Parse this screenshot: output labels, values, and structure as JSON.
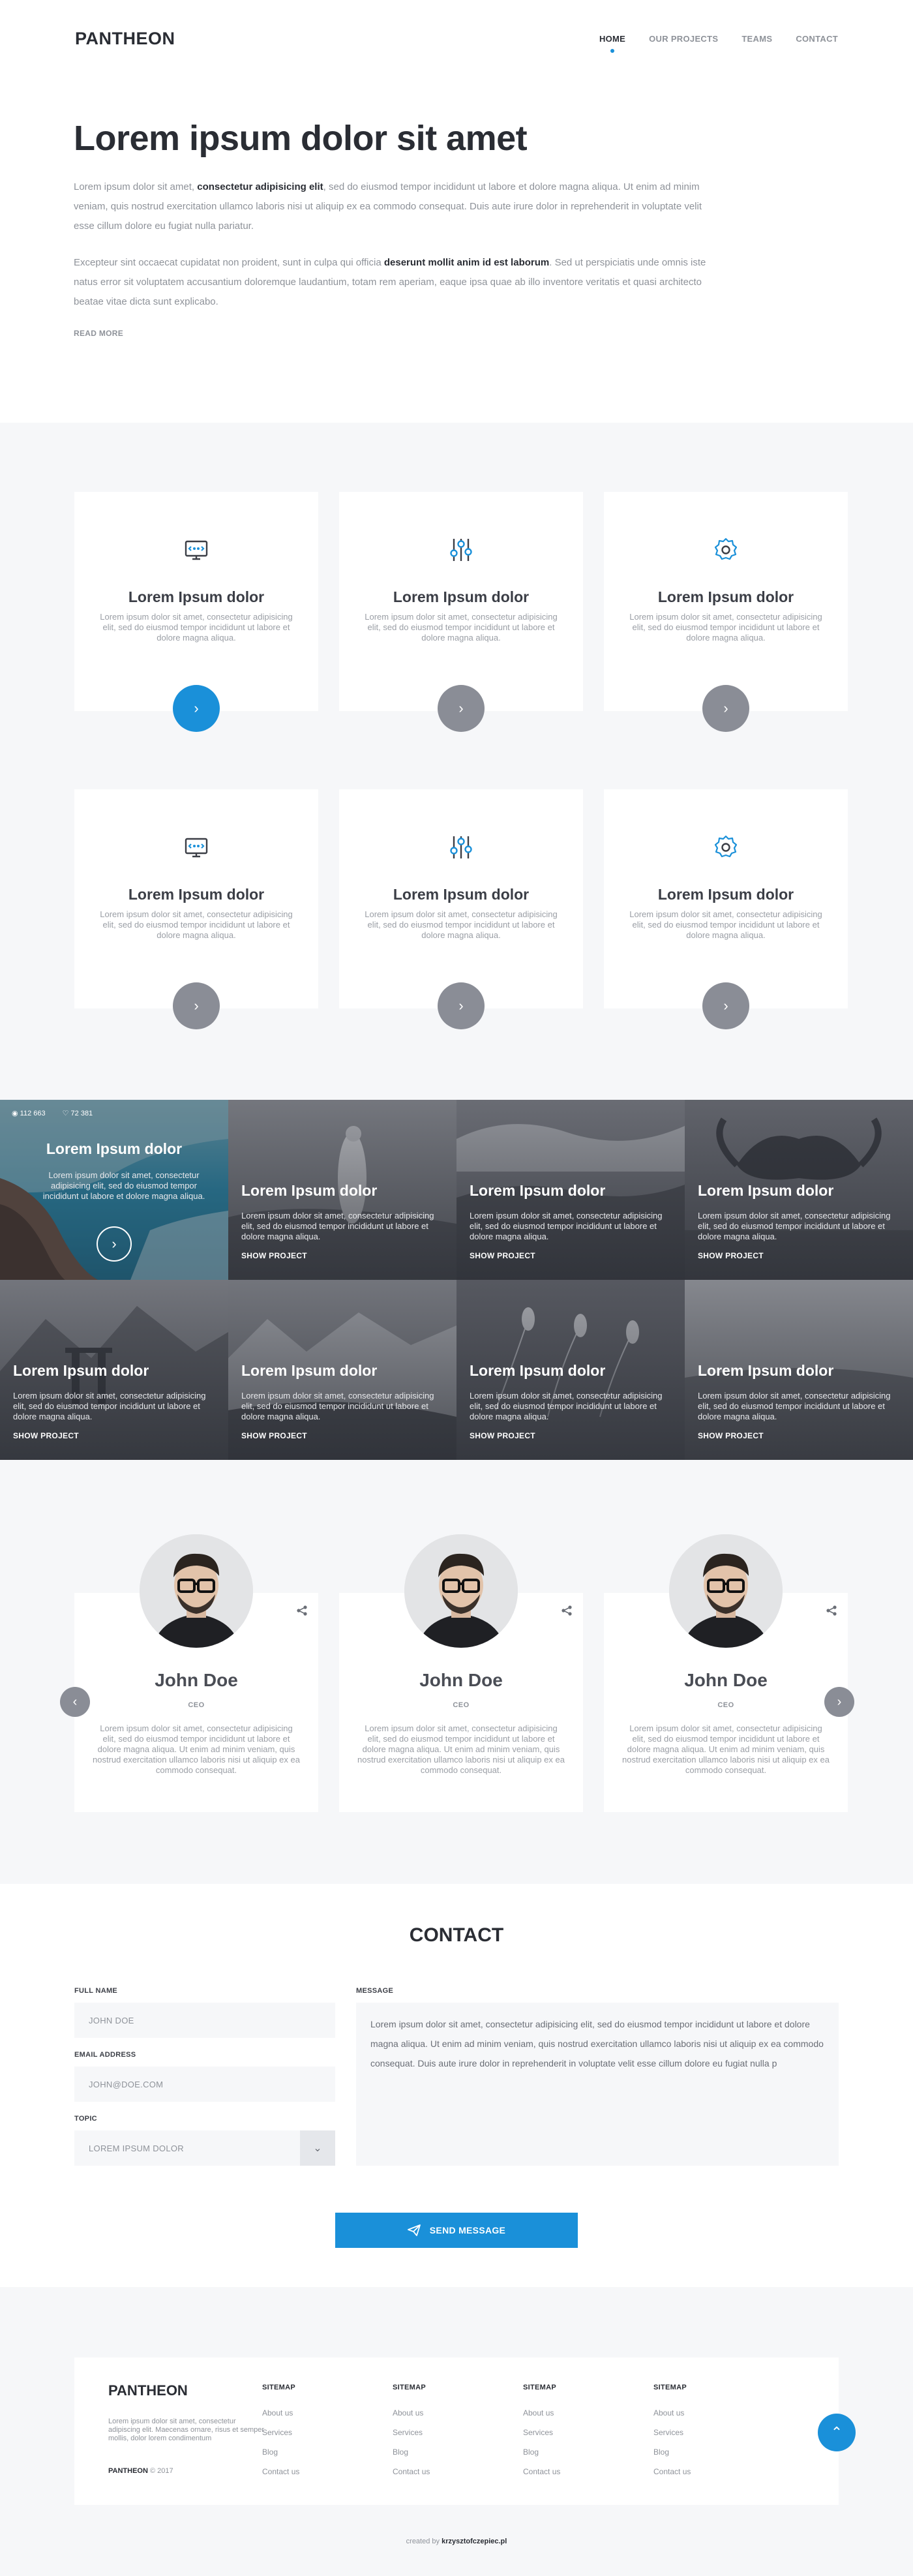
{
  "header": {
    "logo": "PANTHEON",
    "nav": [
      "HOME",
      "OUR PROJECTS",
      "TEAMS",
      "CONTACT"
    ]
  },
  "hero": {
    "title": "Lorem ipsum dolor sit amet",
    "p1_a": "Lorem ipsum dolor sit amet, ",
    "p1_b": "consectetur adipisicing elit",
    "p1_c": ", sed do eiusmod tempor incididunt ut labore et dolore magna aliqua. Ut enim ad minim veniam, quis nostrud exercitation ullamco laboris nisi ut aliquip ex ea commodo consequat. Duis aute irure dolor in reprehenderit in voluptate velit esse cillum dolore eu fugiat nulla pariatur.",
    "p2_a": "Excepteur sint occaecat cupidatat non proident, sunt in culpa qui officia ",
    "p2_b": "deserunt mollit anim id est laborum",
    "p2_c": ". Sed ut perspiciatis unde omnis iste natus error sit voluptatem accusantium doloremque laudantium, totam rem aperiam, eaque ipsa quae ab illo inventore veritatis et quasi architecto beatae vitae dicta sunt explicabo.",
    "read_more": "READ MORE"
  },
  "services": [
    {
      "icon": "monitor-icon",
      "title": "Lorem Ipsum dolor",
      "text": "Lorem ipsum dolor sit amet, consectetur adipisicing elit, sed do eiusmod tempor incididunt ut labore et dolore magna aliqua.",
      "btn": "›"
    },
    {
      "icon": "sliders-icon",
      "title": "Lorem Ipsum dolor",
      "text": "Lorem ipsum dolor sit amet, consectetur adipisicing elit, sed do eiusmod tempor incididunt ut labore et dolore magna aliqua.",
      "btn": "›"
    },
    {
      "icon": "gear-icon",
      "title": "Lorem Ipsum dolor",
      "text": "Lorem ipsum dolor sit amet, consectetur adipisicing elit, sed do eiusmod tempor incididunt ut labore et dolore magna aliqua.",
      "btn": "›"
    },
    {
      "icon": "monitor-icon",
      "title": "Lorem Ipsum dolor",
      "text": "Lorem ipsum dolor sit amet, consectetur adipisicing elit, sed do eiusmod tempor incididunt ut labore et dolore magna aliqua.",
      "btn": "›"
    },
    {
      "icon": "sliders-icon",
      "title": "Lorem Ipsum dolor",
      "text": "Lorem ipsum dolor sit amet, consectetur adipisicing elit, sed do eiusmod tempor incididunt ut labore et dolore magna aliqua.",
      "btn": "›"
    },
    {
      "icon": "gear-icon",
      "title": "Lorem Ipsum dolor",
      "text": "Lorem ipsum dolor sit amet, consectetur adipisicing elit, sed do eiusmod tempor incididunt ut labore et dolore magna aliqua.",
      "btn": "›"
    }
  ],
  "projects": {
    "featured": {
      "views": "112 663",
      "likes": "72 381",
      "title": "Lorem Ipsum dolor",
      "text": "Lorem ipsum dolor sit amet, consectetur adipisicing elit, sed do eiusmod tempor incididunt ut labore et dolore magna aliqua.",
      "play": "›"
    },
    "items": [
      {
        "title": "Lorem Ipsum dolor",
        "text": "Lorem ipsum dolor sit amet, consectetur adipisicing elit, sed do eiusmod tempor incididunt ut labore et dolore magna aliqua.",
        "link": "SHOW PROJECT"
      },
      {
        "title": "Lorem Ipsum dolor",
        "text": "Lorem ipsum dolor sit amet, consectetur adipisicing elit, sed do eiusmod tempor incididunt ut labore et dolore magna aliqua.",
        "link": "SHOW PROJECT"
      },
      {
        "title": "Lorem Ipsum dolor",
        "text": "Lorem ipsum dolor sit amet, consectetur adipisicing elit, sed do eiusmod tempor incididunt ut labore et dolore magna aliqua.",
        "link": "SHOW PROJECT"
      },
      {
        "title": "Lorem Ipsum dolor",
        "text": "Lorem ipsum dolor sit amet, consectetur adipisicing elit, sed do eiusmod tempor incididunt ut labore et dolore magna aliqua.",
        "link": "SHOW PROJECT"
      },
      {
        "title": "Lorem Ipsum dolor",
        "text": "Lorem ipsum dolor sit amet, consectetur adipisicing elit, sed do eiusmod tempor incididunt ut labore et dolore magna aliqua.",
        "link": "SHOW PROJECT"
      },
      {
        "title": "Lorem Ipsum dolor",
        "text": "Lorem ipsum dolor sit amet, consectetur adipisicing elit, sed do eiusmod tempor incididunt ut labore et dolore magna aliqua.",
        "link": "SHOW PROJECT"
      },
      {
        "title": "Lorem Ipsum dolor",
        "text": "Lorem ipsum dolor sit amet, consectetur adipisicing elit, sed do eiusmod tempor incididunt ut labore et dolore magna aliqua.",
        "link": "SHOW PROJECT"
      }
    ]
  },
  "team": {
    "prev": "‹",
    "next": "›",
    "members": [
      {
        "name": "John Doe",
        "role": "CEO",
        "text": "Lorem ipsum dolor sit amet, consectetur adipisicing elit, sed do eiusmod tempor incididunt ut labore et dolore magna aliqua. Ut enim ad minim veniam, quis nostrud exercitation ullamco laboris nisi ut aliquip ex ea commodo consequat."
      },
      {
        "name": "John Doe",
        "role": "CEO",
        "text": "Lorem ipsum dolor sit amet, consectetur adipisicing elit, sed do eiusmod tempor incididunt ut labore et dolore magna aliqua. Ut enim ad minim veniam, quis nostrud exercitation ullamco laboris nisi ut aliquip ex ea commodo consequat."
      },
      {
        "name": "John Doe",
        "role": "CEO",
        "text": "Lorem ipsum dolor sit amet, consectetur adipisicing elit, sed do eiusmod tempor incididunt ut labore et dolore magna aliqua. Ut enim ad minim veniam, quis nostrud exercitation ullamco laboris nisi ut aliquip ex ea commodo consequat."
      }
    ]
  },
  "contact": {
    "title": "CONTACT",
    "full_name_label": "FULL NAME",
    "full_name_value": "JOHN DOE",
    "email_label": "EMAIL ADDRESS",
    "email_value": "JOHN@DOE.COM",
    "topic_label": "TOPIC",
    "topic_value": "LOREM IPSUM DOLOR",
    "topic_arrow": "⌄",
    "message_label": "MESSAGE",
    "message_value": "Lorem ipsum dolor sit amet, consectetur adipisicing elit, sed do eiusmod tempor incididunt ut labore et dolore magna aliqua. Ut enim ad minim veniam, quis nostrud exercitation ullamco laboris nisi ut aliquip ex ea commodo consequat. Duis aute irure dolor in reprehenderit in voluptate velit esse cillum dolore eu fugiat nulla p",
    "send": "SEND MESSAGE"
  },
  "footer": {
    "logo": "PANTHEON",
    "desc": "Lorem ipsum dolor sit amet, consectetur adipiscing elit. Maecenas ornare, risus et semper mollis, dolor lorem condimentum",
    "copy_brand": "PANTHEON",
    "copy_year": " © 2017",
    "columns": [
      {
        "title": "SITEMAP",
        "links": [
          "About us",
          "Services",
          "Blog",
          "Contact us"
        ]
      },
      {
        "title": "SITEMAP",
        "links": [
          "About us",
          "Services",
          "Blog",
          "Contact us"
        ]
      },
      {
        "title": "SITEMAP",
        "links": [
          "About us",
          "Services",
          "Blog",
          "Contact us"
        ]
      },
      {
        "title": "SITEMAP",
        "links": [
          "About us",
          "Services",
          "Blog",
          "Contact us"
        ]
      }
    ],
    "top": "⌃",
    "credit_prefix": "created by ",
    "credit_author": "krzysztofczepiec.pl"
  },
  "colors": {
    "accent": "#1a90d9",
    "text": "#2a2d34",
    "muted": "#8e9299",
    "bg_alt": "#f6f7f9"
  }
}
